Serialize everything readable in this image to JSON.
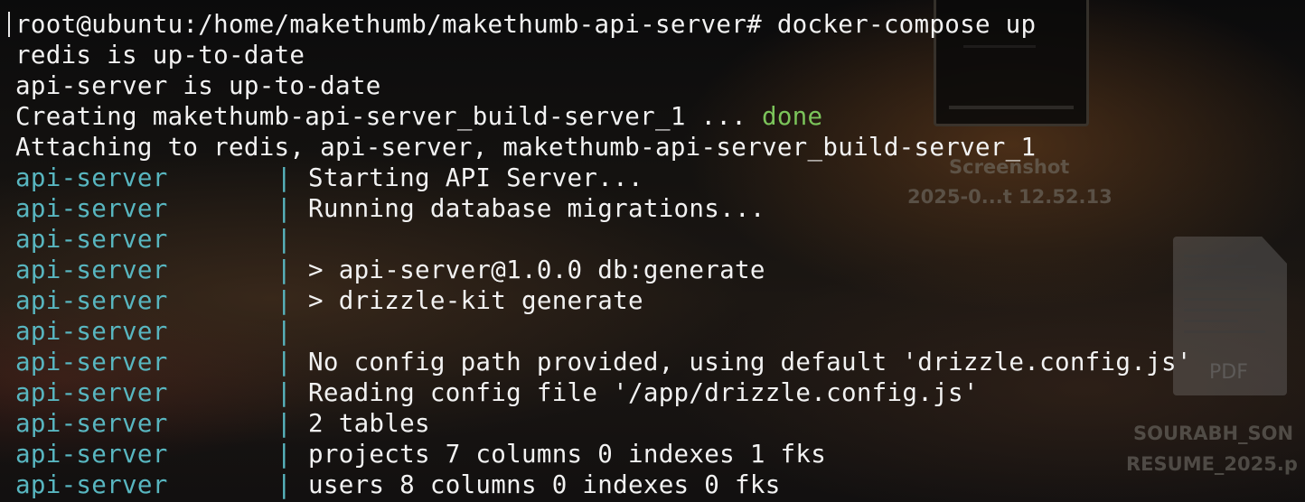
{
  "desktop": {
    "screenshot_label_line1": "Screenshot",
    "screenshot_label_line2": "2025-0...t 12.52.13",
    "pdf_badge": "PDF",
    "resume_label_line1": "SOURABH_SON",
    "resume_label_line2": "RESUME_2025.p"
  },
  "terminal": {
    "prompt_command": "root@ubuntu:/home/makethumb/makethumb-api-server# docker-compose up",
    "status_lines": [
      "redis is up-to-date",
      "api-server is up-to-date"
    ],
    "creating_prefix": "Creating makethumb-api-server_build-server_1 ... ",
    "creating_status": "done",
    "attaching_line": "Attaching to redis, api-server, makethumb-api-server_build-server_1",
    "service_name": "api-server",
    "pipe": "|",
    "log_lines": [
      "Starting API Server...",
      "Running database migrations...",
      "",
      "> api-server@1.0.0 db:generate",
      "> drizzle-kit generate",
      "",
      "No config path provided, using default 'drizzle.config.js'",
      "Reading config file '/app/drizzle.config.js'",
      "2 tables",
      "projects 7 columns 0 indexes 1 fks",
      "users 8 columns 0 indexes 0 fks"
    ]
  },
  "colors": {
    "service_prefix": "#58b6c0",
    "done_status": "#7bc45a",
    "text": "#f2f2f2"
  }
}
